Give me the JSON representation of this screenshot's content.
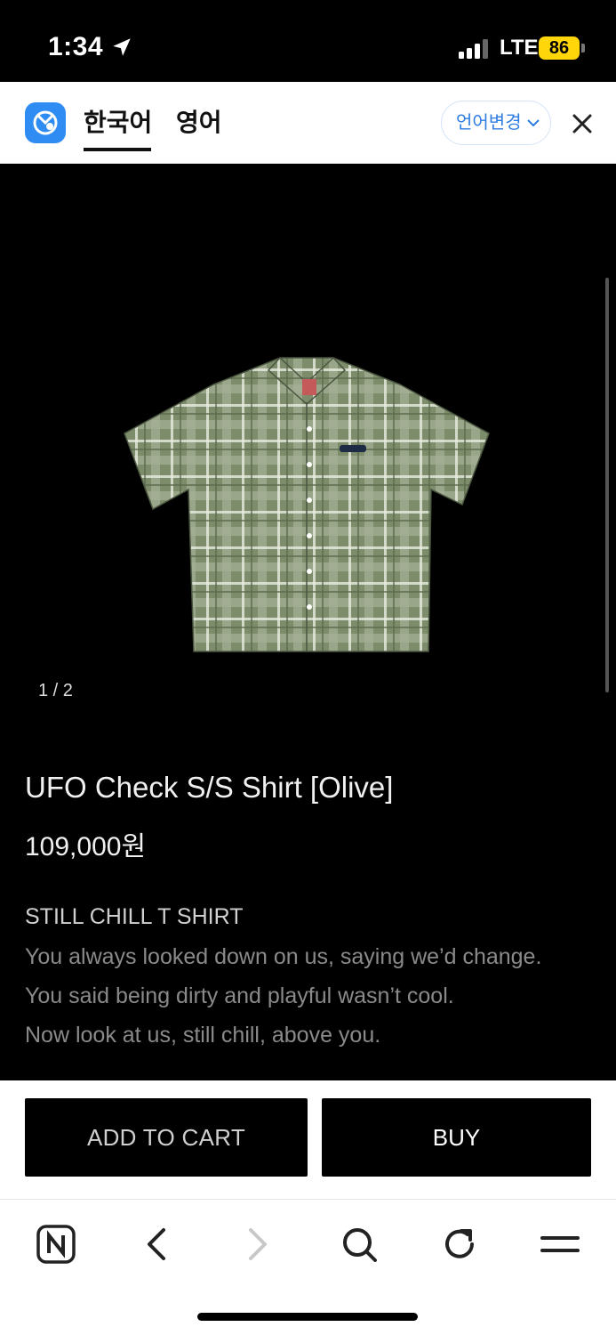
{
  "status_bar": {
    "time": "1:34",
    "network": "LTE",
    "battery": "86",
    "icons": [
      "location-arrow-icon",
      "signal-icon",
      "battery-icon"
    ]
  },
  "translate_bar": {
    "tabs": [
      {
        "label": "한국어",
        "active": true
      },
      {
        "label": "영어",
        "active": false
      }
    ],
    "change_language_label": "언어변경",
    "icons": [
      "papago-logo-icon",
      "chevron-down-icon",
      "close-icon"
    ],
    "accent_color": "#2f8cf3"
  },
  "product": {
    "pager": "1 / 2",
    "title": "UFO Check S/S Shirt [Olive]",
    "price": "109,000원",
    "description_title": "STILL CHILL T SHIRT",
    "description_lines": [
      "You always looked down on us, saying we’d change.",
      "You said being dirty and playful wasn’t cool.",
      "Now look at us, still chill, above you."
    ]
  },
  "actions": {
    "add_to_cart_label": "ADD TO CART",
    "buy_label": "BUY"
  },
  "browser_toolbar": {
    "icons": [
      "naver-home-icon",
      "back-icon",
      "forward-icon",
      "search-icon",
      "refresh-icon",
      "menu-icon"
    ]
  }
}
